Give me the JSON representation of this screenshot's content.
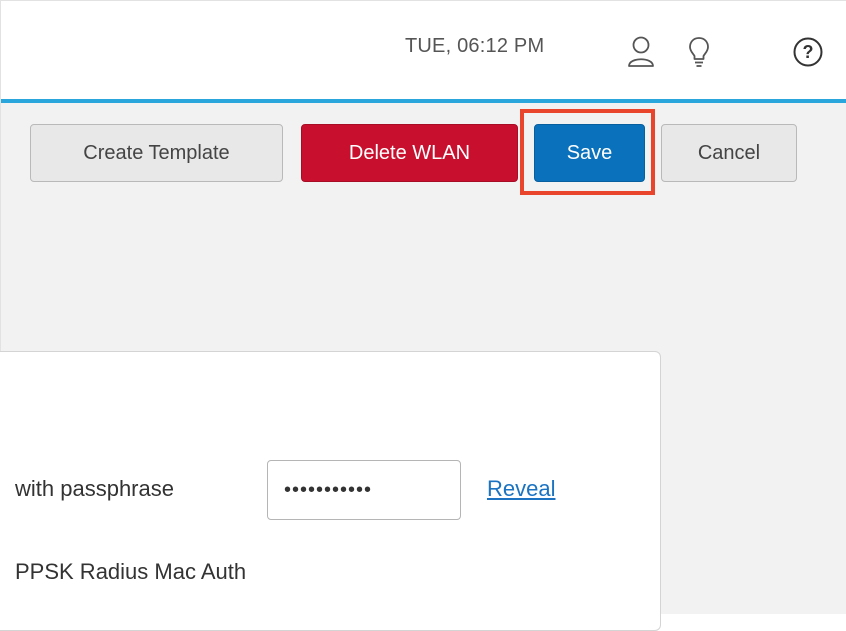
{
  "header": {
    "clock": "TUE, 06:12 PM",
    "icons": [
      "user-icon",
      "lightbulb-icon",
      "help-icon"
    ],
    "accent_color": "#2aa6dc"
  },
  "toolbar": {
    "create_template_label": "Create Template",
    "delete_wlan_label": "Delete WLAN",
    "save_label": "Save",
    "cancel_label": "Cancel",
    "delete_color": "#c8102e",
    "save_color": "#0a72bd",
    "highlight_color": "#e8452c"
  },
  "form": {
    "passphrase_label": "with passphrase",
    "passphrase_value": "•••••••••••",
    "reveal_label": "Reveal",
    "ppsk_label": "PPSK Radius Mac Auth"
  }
}
